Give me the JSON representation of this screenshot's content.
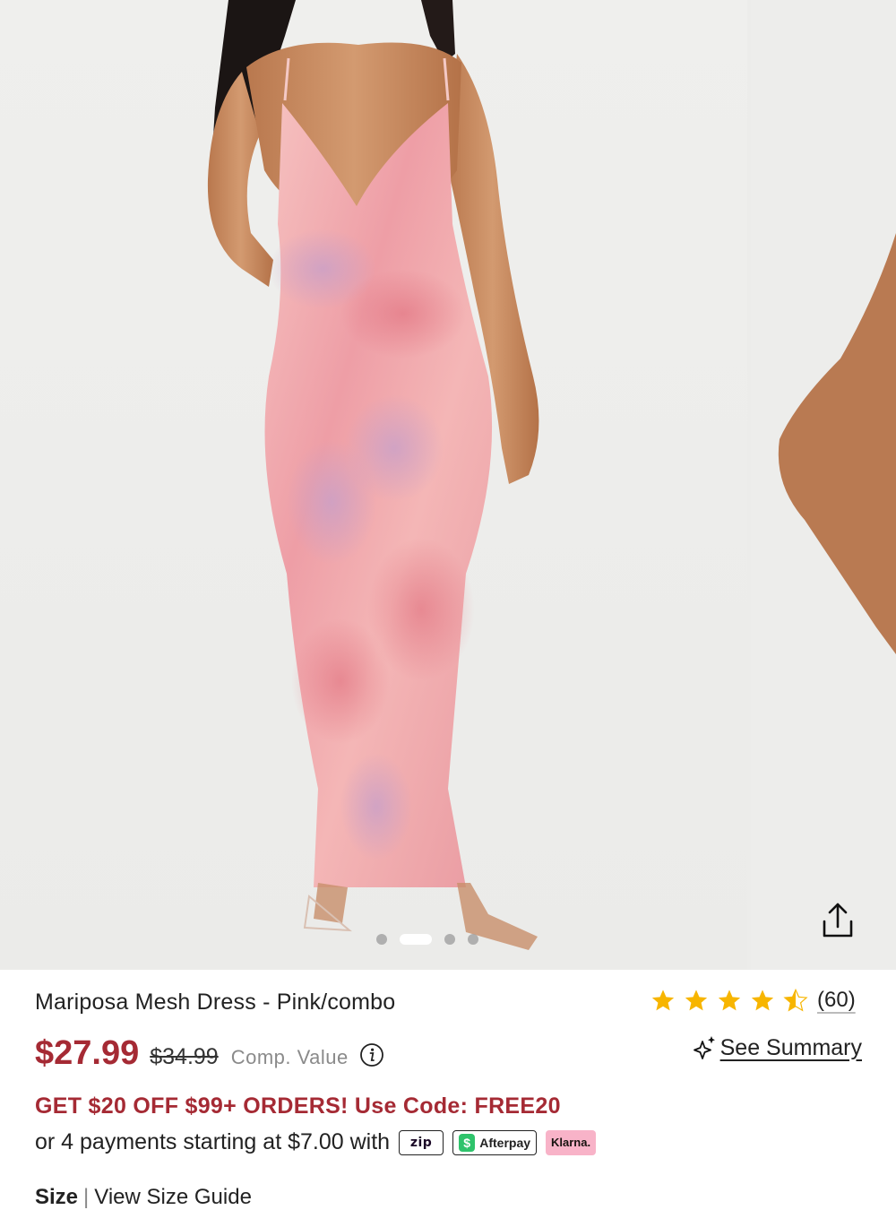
{
  "product": {
    "title": "Mariposa Mesh Dress - Pink/combo",
    "price": "$27.99",
    "original_price": "$34.99",
    "comp_value_label": "Comp. Value",
    "rating_stars": 4.5,
    "rating_count": "(60)",
    "see_summary_label": "See Summary"
  },
  "promo": {
    "text": "GET $20 OFF $99+ ORDERS! Use Code: FREE20"
  },
  "installments": {
    "text": "or 4 payments starting at $7.00 with",
    "providers": [
      {
        "name": "zip",
        "label": "zip"
      },
      {
        "name": "afterpay",
        "label": "Afterpay"
      },
      {
        "name": "klarna",
        "label": "Klarna."
      }
    ]
  },
  "gallery": {
    "image_count": 4,
    "active_index": 1
  },
  "size": {
    "label": "Size",
    "guide_label": "View Size Guide"
  },
  "colors": {
    "sale_red": "#a52a34",
    "star_yellow": "#f7b500",
    "dress_pink": "#f2b3b8",
    "klarna_pink": "#f8b3c8",
    "afterpay_green": "#2ec36b"
  },
  "icons": [
    "share-icon",
    "star-icon",
    "info-icon",
    "sparkle-icon"
  ]
}
